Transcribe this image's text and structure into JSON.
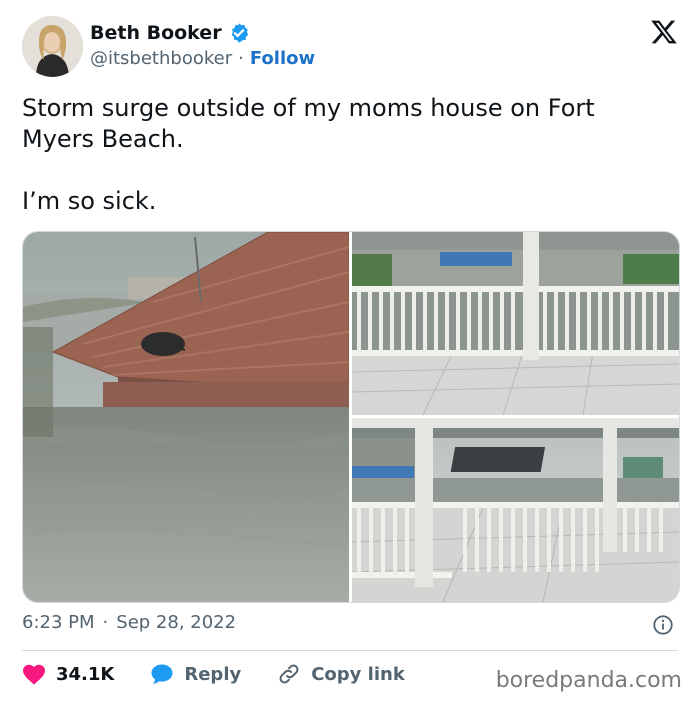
{
  "author": {
    "name": "Beth Booker",
    "handle": "@itsbethbooker",
    "separator": "·",
    "follow_label": "Follow"
  },
  "tweet": {
    "text": "Storm surge outside of my moms house on Fort\nMyers Beach.\n\nI’m so sick."
  },
  "meta": {
    "time": "6:23 PM",
    "separator": "·",
    "date": "Sep 28, 2022"
  },
  "actions": {
    "likes": "34.1K",
    "reply_label": "Reply",
    "copy_label": "Copy link"
  },
  "watermark": "boredpanda.com",
  "colors": {
    "like": "#f91880",
    "reply": "#1d9bf0",
    "verified": "#1d9bf0",
    "link": "#1d73c9"
  },
  "icons": {
    "brand": "x-logo-icon",
    "verified": "verified-badge-icon",
    "like": "heart-icon",
    "reply": "speech-bubble-icon",
    "copy": "link-icon",
    "info": "info-icon"
  }
}
